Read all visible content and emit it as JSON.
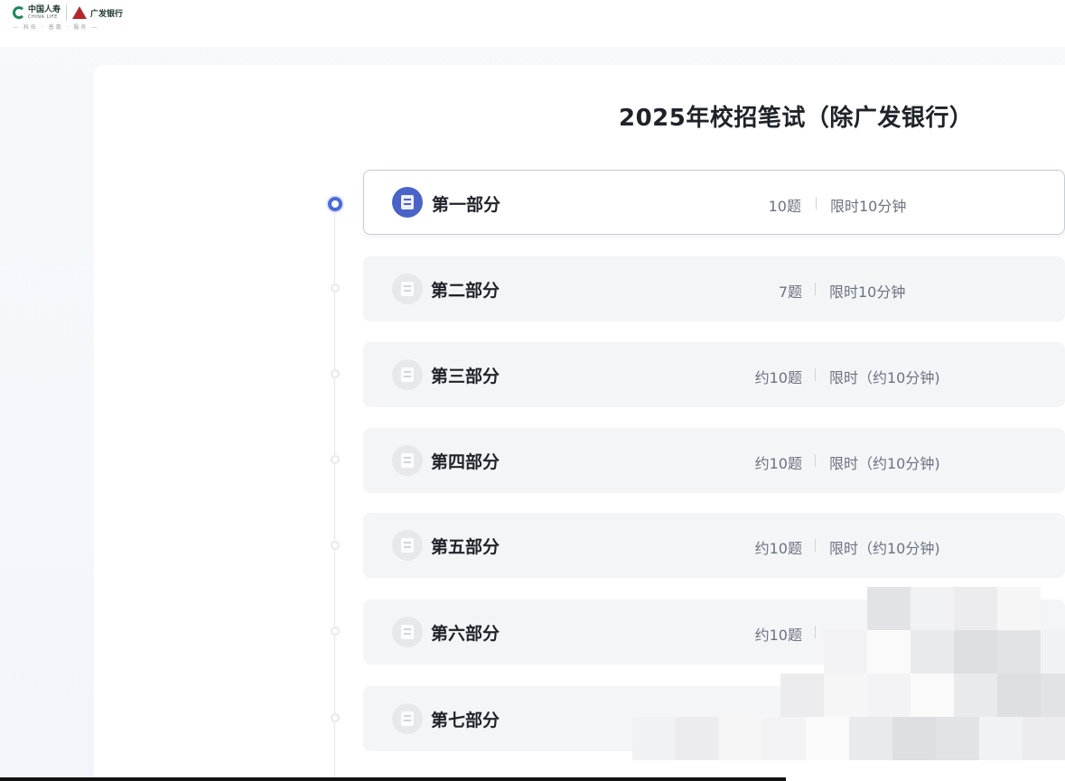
{
  "header": {
    "logo_life_name": "中国人寿",
    "logo_life_sub": "CHINA LIFE",
    "logo_bank_name": "广发银行",
    "slogan": "— 科技 · 普惠 · 服务 —"
  },
  "page": {
    "title": "2025年校招笔试（除广发银行）"
  },
  "sections": [
    {
      "name": "第一部分",
      "count": "10题",
      "time": "限时10分钟"
    },
    {
      "name": "第二部分",
      "count": "7题",
      "time": "限时10分钟"
    },
    {
      "name": "第三部分",
      "count": "约10题",
      "time": "限时（约10分钟)"
    },
    {
      "name": "第四部分",
      "count": "约10题",
      "time": "限时（约10分钟)"
    },
    {
      "name": "第五部分",
      "count": "约10题",
      "time": "限时（约10分钟)"
    },
    {
      "name": "第六部分",
      "count": "约10题",
      "time": ""
    },
    {
      "name": "第七部分",
      "count": "",
      "time": ""
    }
  ],
  "active_section_index": 0,
  "colors": {
    "accent": "#4a63c8",
    "life_green": "#1b8a55",
    "bank_red": "#b3262e"
  },
  "icons": {
    "section_icon": "document-icon",
    "life_logo": "china-life-logo-icon",
    "bank_logo": "cgb-logo-icon"
  }
}
